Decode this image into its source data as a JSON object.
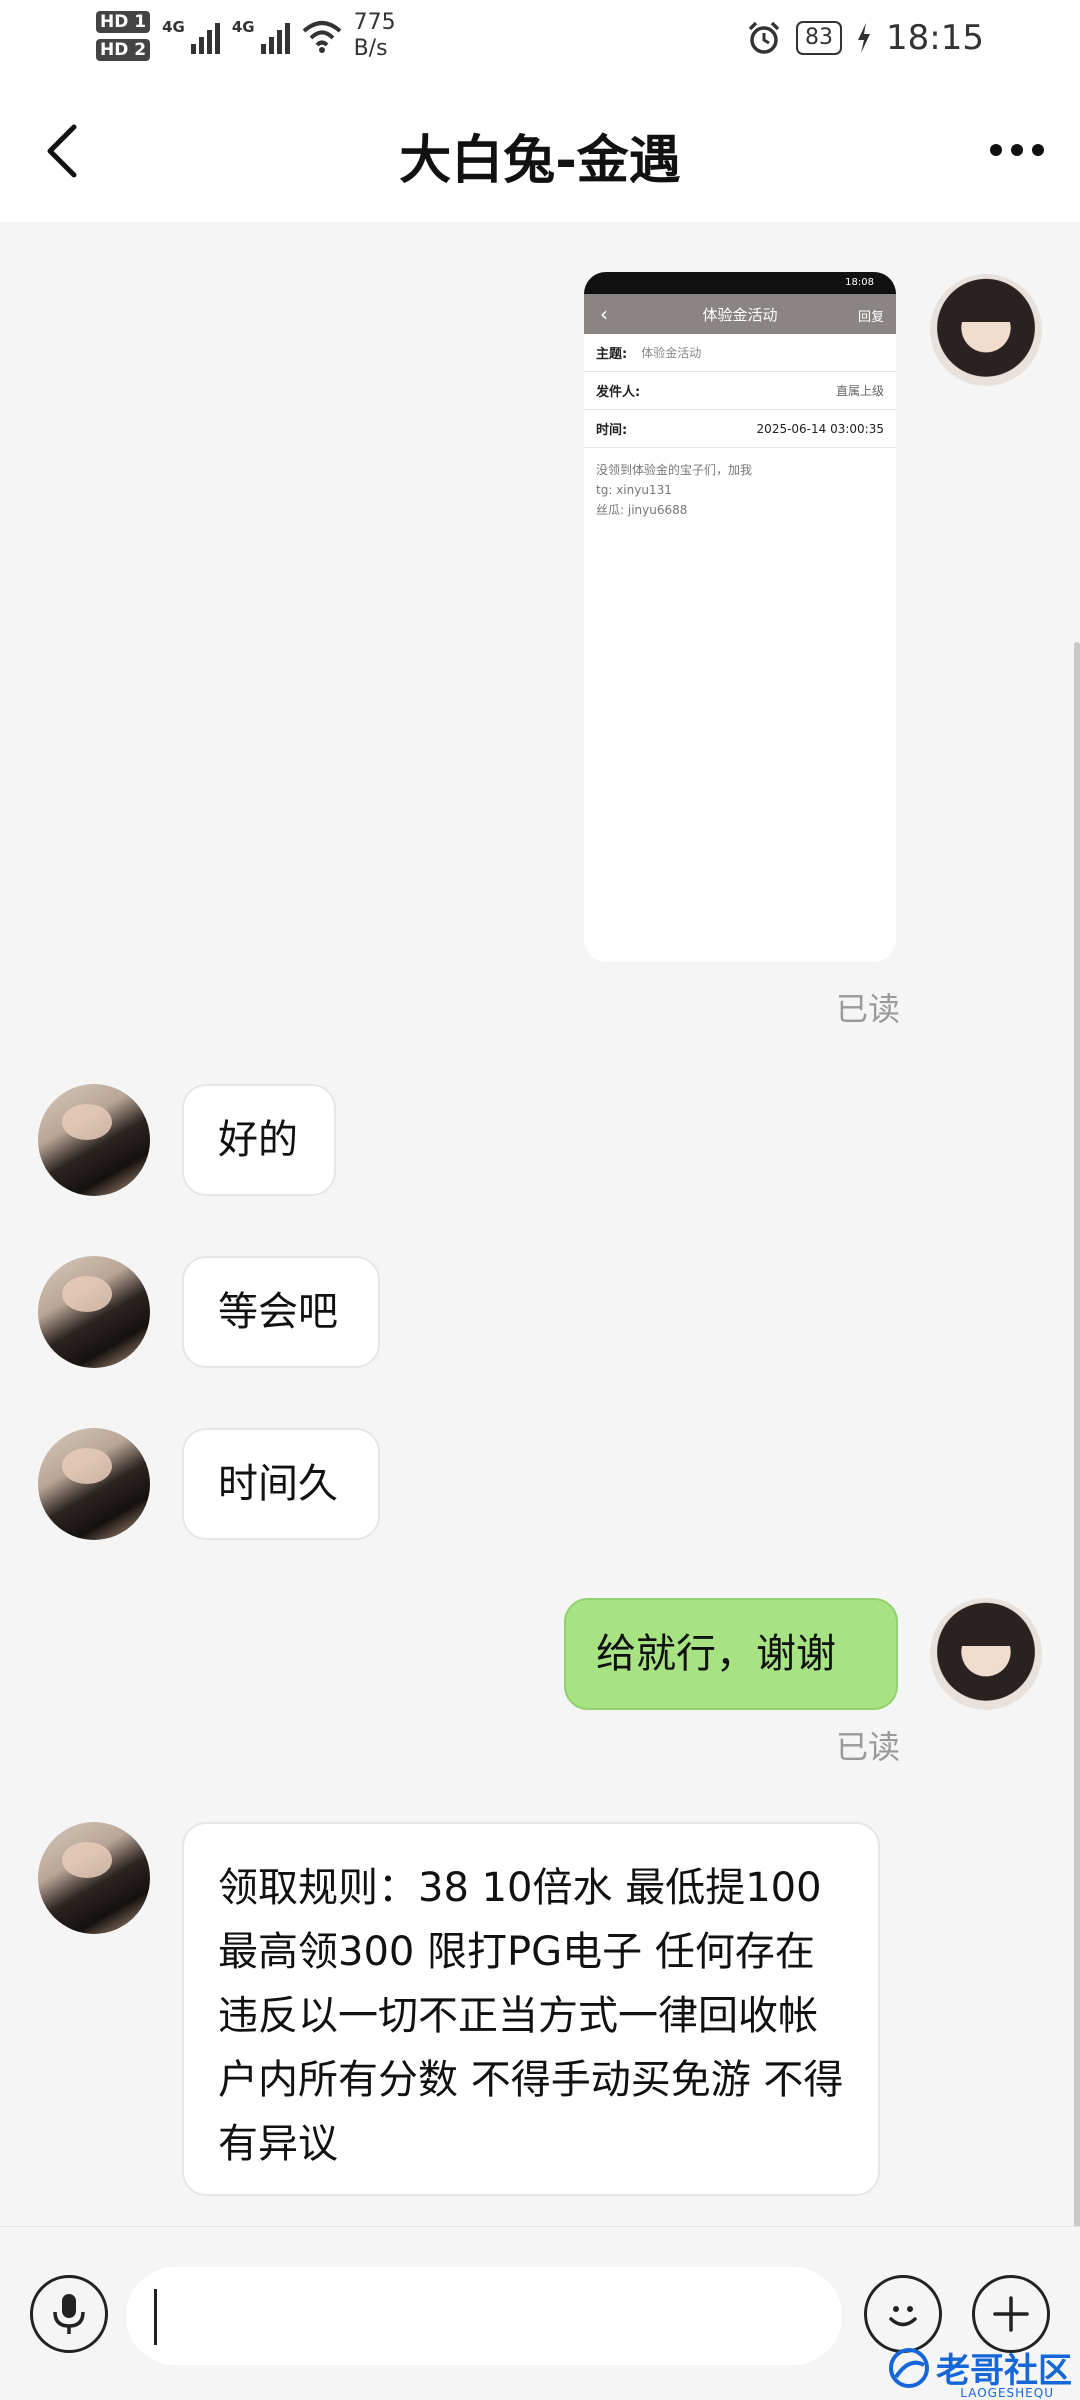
{
  "status_bar": {
    "hd1": "HD 1",
    "hd2": "HD 2",
    "net1": "4G",
    "net2": "4G",
    "speed_value": "775",
    "speed_unit": "B/s",
    "battery": "83",
    "time": "18:15"
  },
  "header": {
    "title": "大白兔-金遇",
    "back_icon": "chevron-left-icon",
    "more_icon": "more-dots-icon"
  },
  "shared_screenshot": {
    "status_time": "18:08",
    "title": "体验金活动",
    "reply": "回复",
    "subject_label": "主题:",
    "subject_value": "体验金活动",
    "sender_label": "发件人:",
    "sender_value": "直属上级",
    "time_label": "时间:",
    "time_value": "2025-06-14 03:00:35",
    "body_line1": "没领到体验金的宝子们，加我",
    "body_line2": "tg:  xinyu131",
    "body_line3": "丝瓜:  jinyu6688"
  },
  "messages": [
    {
      "side": "out",
      "type": "image",
      "read": "已读"
    },
    {
      "side": "in",
      "text": "好的"
    },
    {
      "side": "in",
      "text": "等会吧"
    },
    {
      "side": "in",
      "text": "时间久"
    },
    {
      "side": "out",
      "text": "给就行，谢谢",
      "read": "已读"
    },
    {
      "side": "in",
      "text": "领取规则：38 10倍水 最低提100最高领300 限打PG电子 任何存在违反以一切不正当方式一律回收帐户内所有分数 不得手动买免游 不得有异议"
    }
  ],
  "input_bar": {
    "voice_icon": "microphone-icon",
    "emoji_icon": "emoji-icon",
    "plus_icon": "plus-icon",
    "input_value": ""
  },
  "watermark": {
    "text": "老哥社区",
    "sub": "LAOGESHEQU"
  },
  "colors": {
    "outgoing_bubble": "#a7e383",
    "incoming_bubble": "#ffffff",
    "background": "#f5f5f5",
    "watermark": "#1566d8"
  }
}
